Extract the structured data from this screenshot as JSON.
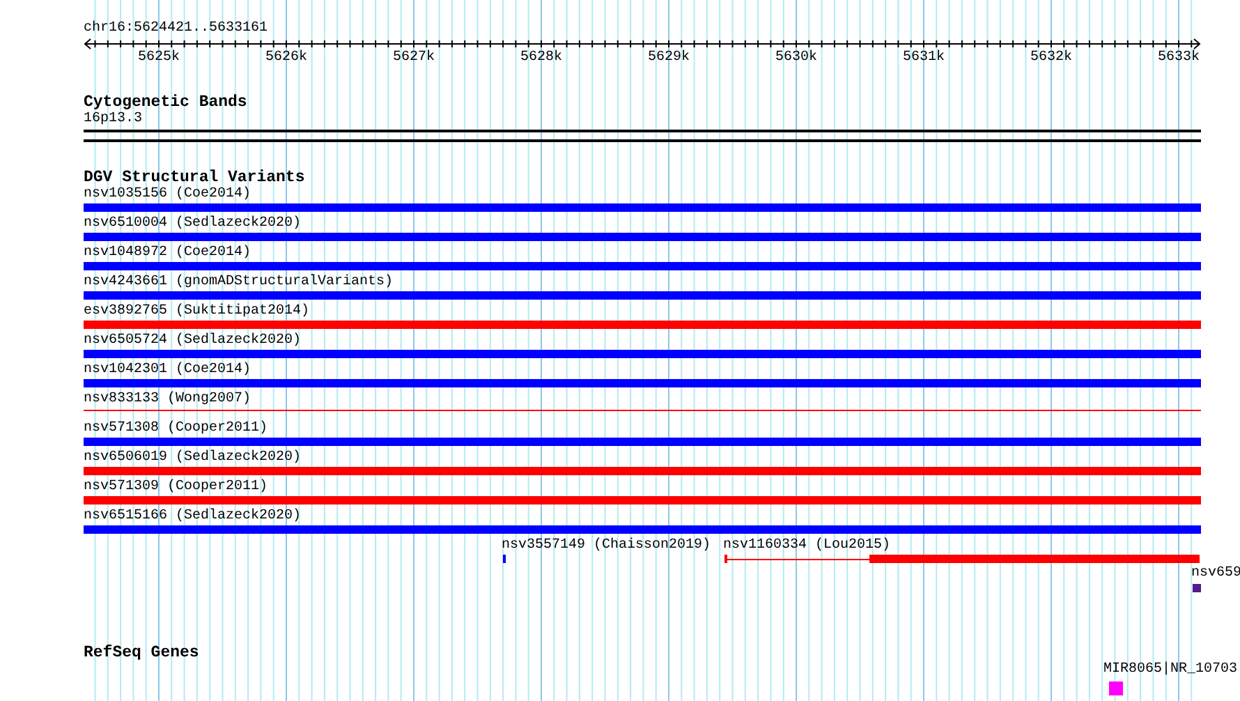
{
  "ruler": {
    "location": "chr16:5624421..5633161",
    "tick_labels": [
      "5625k",
      "5626k",
      "5627k",
      "5628k",
      "5629k",
      "5630k",
      "5631k",
      "5632k",
      "5633k"
    ]
  },
  "cytogenetic_bands": {
    "title": "Cytogenetic Bands",
    "band": "16p13.3"
  },
  "dgv": {
    "title": "DGV Structural Variants",
    "variants": [
      {
        "label": "nsv1035156 (Coe2014)",
        "color": "#0000ff",
        "kind": "thick"
      },
      {
        "label": "nsv6510004 (Sedlazeck2020)",
        "color": "#0000ff",
        "kind": "thick"
      },
      {
        "label": "nsv1048972 (Coe2014)",
        "color": "#0000ff",
        "kind": "thick"
      },
      {
        "label": "nsv4243661 (gnomADStructuralVariants)",
        "color": "#0000ff",
        "kind": "thick"
      },
      {
        "label": "esv3892765 (Suktitipat2014)",
        "color": "#ff0000",
        "kind": "thick"
      },
      {
        "label": "nsv6505724 (Sedlazeck2020)",
        "color": "#0000ff",
        "kind": "thick"
      },
      {
        "label": "nsv1042301 (Coe2014)",
        "color": "#0000ff",
        "kind": "thick"
      },
      {
        "label": "nsv833133 (Wong2007)",
        "color": "#ff0000",
        "kind": "thin"
      },
      {
        "label": "nsv571308 (Cooper2011)",
        "color": "#0000ff",
        "kind": "thick"
      },
      {
        "label": "nsv6506019 (Sedlazeck2020)",
        "color": "#ff0000",
        "kind": "thick"
      },
      {
        "label": "nsv571309 (Cooper2011)",
        "color": "#ff0000",
        "kind": "thick"
      },
      {
        "label": "nsv6515166 (Sedlazeck2020)",
        "color": "#0000ff",
        "kind": "thick"
      }
    ],
    "partial_features": [
      {
        "label": "nsv3557149 (Chaisson2019)",
        "color": "#0000ff",
        "kind": "tick"
      },
      {
        "label": "nsv1160334 (Lou2015)",
        "color": "#ff0000",
        "kind": "split"
      },
      {
        "label": "nsv659",
        "color": "#551a8b",
        "kind": "square"
      }
    ]
  },
  "refseq": {
    "title": "RefSeq Genes",
    "genes": [
      {
        "label": "MIR8065|NR_10703",
        "color": "#ff00ff"
      }
    ]
  }
}
